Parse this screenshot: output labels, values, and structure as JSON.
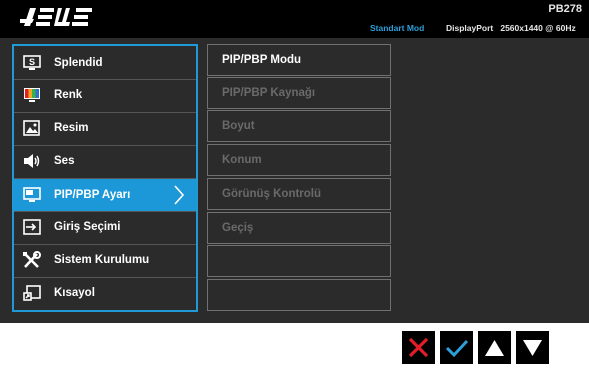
{
  "header": {
    "logo_text": "ASUS",
    "model": "PB278",
    "mode": "Standart Mod",
    "input": "DisplayPort",
    "resolution": "2560x1440 @ 60Hz"
  },
  "main_menu": {
    "items": [
      {
        "label": "Splendid",
        "icon": "splendid-icon"
      },
      {
        "label": "Renk",
        "icon": "color-icon"
      },
      {
        "label": "Resim",
        "icon": "image-icon"
      },
      {
        "label": "Ses",
        "icon": "speaker-icon"
      },
      {
        "label": "PIP/PBP Ayarı",
        "icon": "pip-icon",
        "selected": true
      },
      {
        "label": "Giriş Seçimi",
        "icon": "input-select-icon"
      },
      {
        "label": "Sistem Kurulumu",
        "icon": "wrench-screwdriver-icon"
      },
      {
        "label": "Kısayol",
        "icon": "shortcut-icon"
      }
    ]
  },
  "sub_menu": {
    "items": [
      {
        "label": "PIP/PBP Modu",
        "active": true
      },
      {
        "label": "PIP/PBP Kaynağı",
        "active": false
      },
      {
        "label": "Boyut",
        "active": false
      },
      {
        "label": "Konum",
        "active": false
      },
      {
        "label": "Görünüş Kontrolü",
        "active": false
      },
      {
        "label": "Geçiş",
        "active": false
      },
      {
        "label": "",
        "active": false
      },
      {
        "label": "",
        "active": false
      }
    ]
  },
  "buttons": [
    {
      "icon": "close-icon"
    },
    {
      "icon": "check-icon"
    },
    {
      "icon": "up-arrow-icon"
    },
    {
      "icon": "down-arrow-icon"
    }
  ],
  "colors": {
    "accent": "#1c97d8",
    "close": "#e41e26",
    "check": "#2d9fd9"
  }
}
